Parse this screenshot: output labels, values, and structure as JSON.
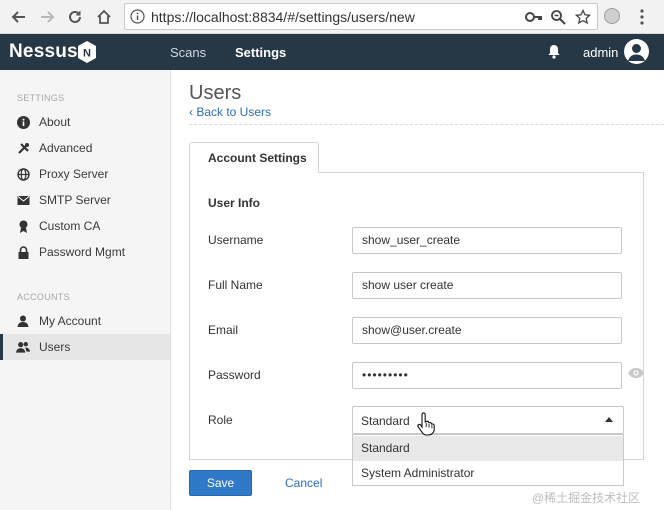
{
  "browser": {
    "url": "https://localhost:8834/#/settings/users/new",
    "back_icon": "arrow-left-icon",
    "forward_icon": "arrow-right-icon",
    "reload_icon": "reload-icon",
    "home_icon": "home-icon"
  },
  "header": {
    "logo": "Nessus",
    "logo_badge": "N",
    "nav": [
      {
        "label": "Scans",
        "active": false
      },
      {
        "label": "Settings",
        "active": true
      }
    ],
    "user": "admin",
    "colors": {
      "bar": "#263746",
      "accent": "#2f79c8"
    }
  },
  "sidebar": {
    "settings_heading": "SETTINGS",
    "settings_items": [
      {
        "label": "About",
        "icon": "info-icon"
      },
      {
        "label": "Advanced",
        "icon": "tools-icon"
      },
      {
        "label": "Proxy Server",
        "icon": "globe-icon"
      },
      {
        "label": "SMTP Server",
        "icon": "envelope-icon"
      },
      {
        "label": "Custom CA",
        "icon": "certificate-icon"
      },
      {
        "label": "Password Mgmt",
        "icon": "lock-icon"
      }
    ],
    "accounts_heading": "ACCOUNTS",
    "accounts_items": [
      {
        "label": "My Account",
        "icon": "user-icon",
        "active": false
      },
      {
        "label": "Users",
        "icon": "users-icon",
        "active": true
      }
    ]
  },
  "main": {
    "title": "Users",
    "back_link": "‹ Back to Users",
    "tab": "Account Settings",
    "section": "User Info",
    "fields": {
      "username": {
        "label": "Username",
        "value": "show_user_create"
      },
      "full_name": {
        "label": "Full Name",
        "value": "show user create"
      },
      "email": {
        "label": "Email",
        "value": "show@user.create"
      },
      "password": {
        "label": "Password",
        "value": "•••••••••"
      },
      "role": {
        "label": "Role",
        "value": "Standard",
        "options": [
          "Standard",
          "System Administrator"
        ],
        "highlighted_option": "Standard"
      }
    },
    "save_label": "Save",
    "cancel_label": "Cancel"
  },
  "watermark": "@稀土掘金技术社区"
}
